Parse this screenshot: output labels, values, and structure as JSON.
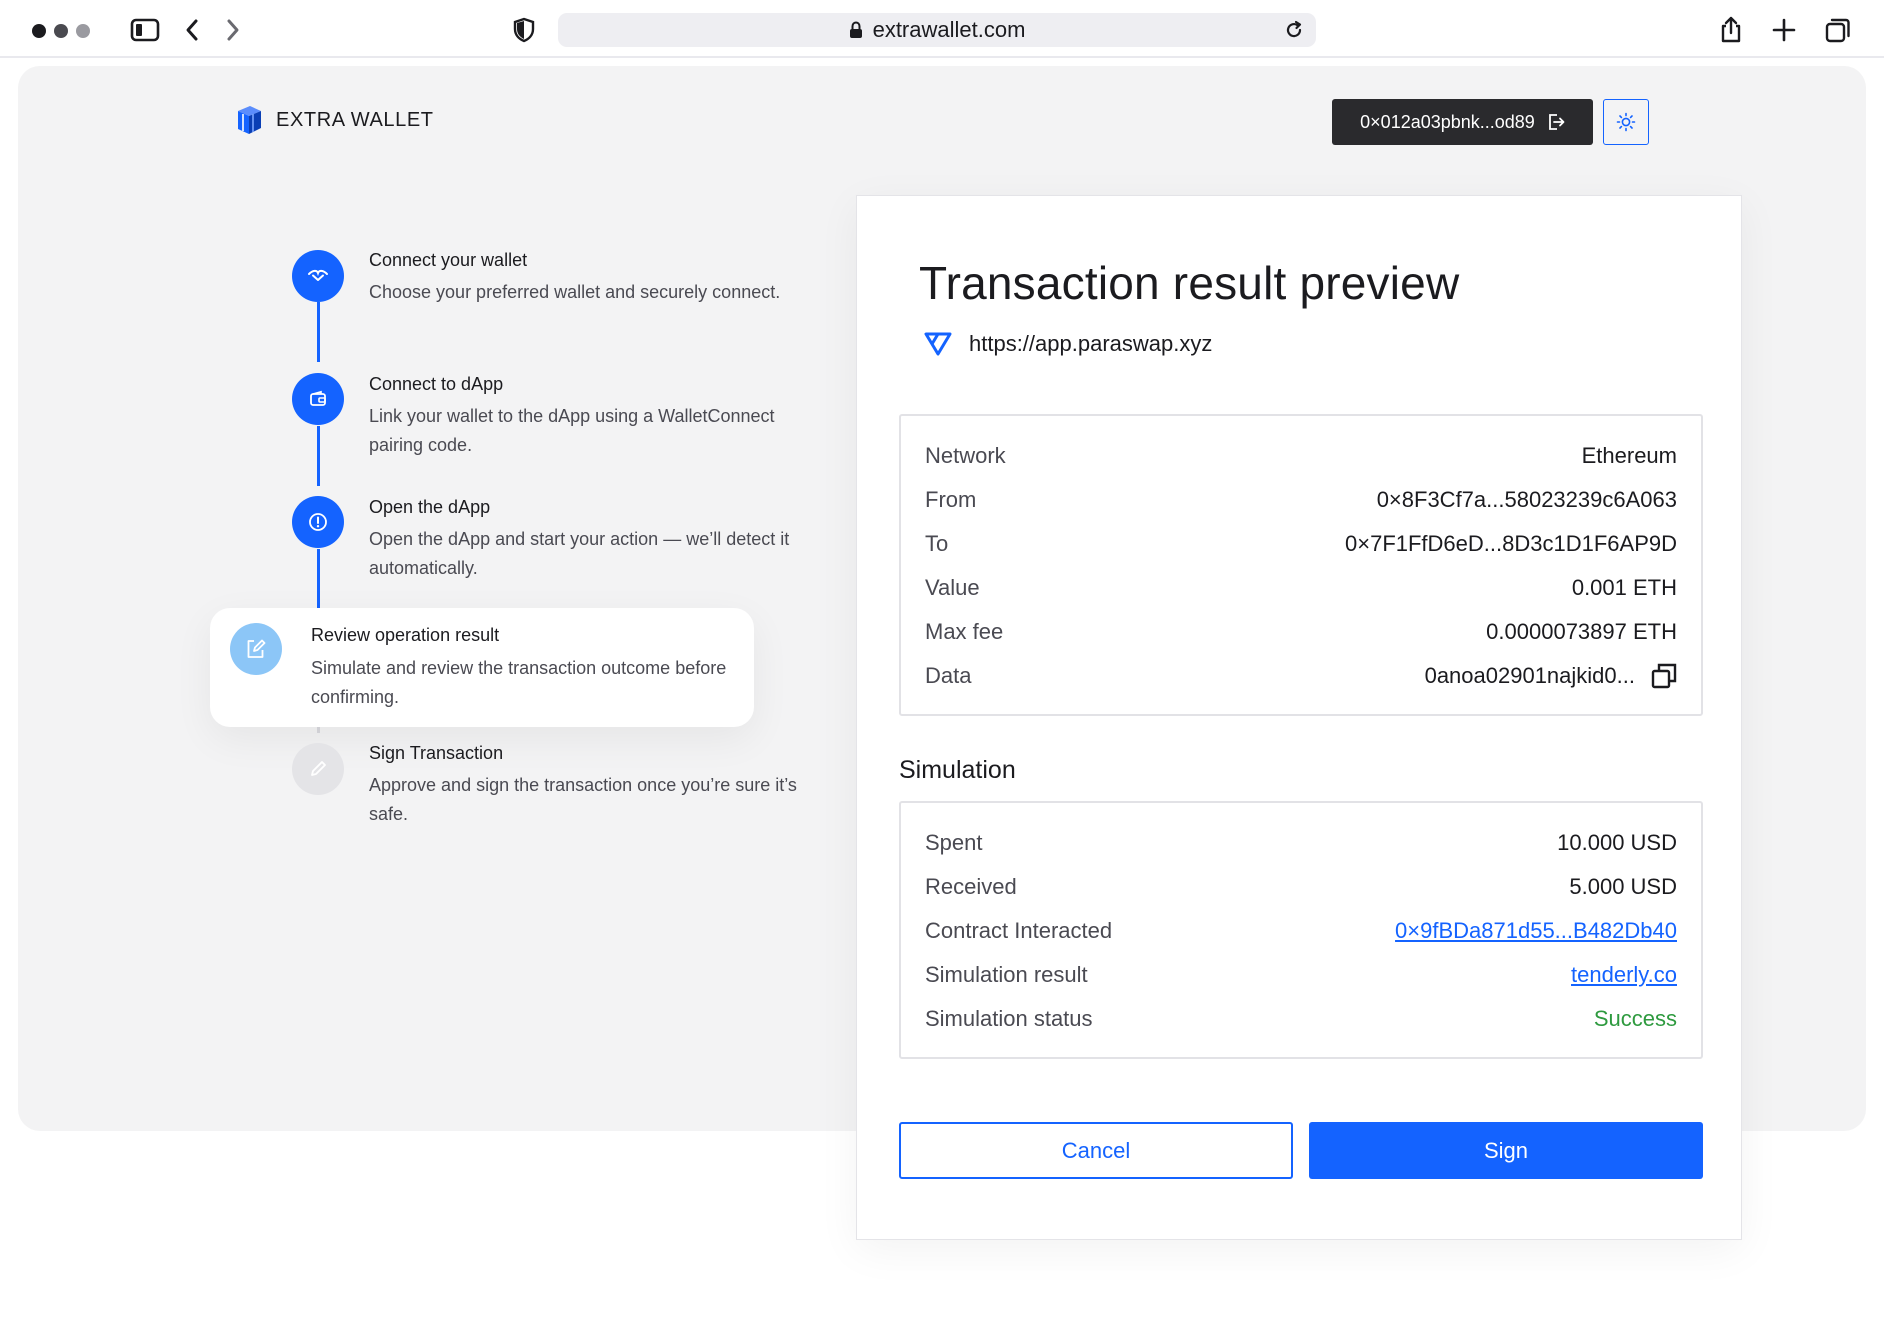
{
  "browser": {
    "url": "extrawallet.com"
  },
  "app": {
    "brand": "EXTRA WALLET",
    "address": "0×012a03pbnk...od89"
  },
  "steps": [
    {
      "title": "Connect your wallet",
      "desc": "Choose your preferred wallet and securely connect.",
      "icon": "wave-icon",
      "state": "done"
    },
    {
      "title": "Connect to dApp",
      "desc": "Link your wallet to the dApp using a WalletConnect pairing code.",
      "icon": "wallet-icon",
      "state": "done"
    },
    {
      "title": "Open the dApp",
      "desc": "Open the dApp and start your action — we’ll detect it automatically.",
      "icon": "info-icon",
      "state": "done"
    },
    {
      "title": "Review operation result",
      "desc": "Simulate and review the transaction outcome before confirming.",
      "icon": "edit-doc-icon",
      "state": "active"
    },
    {
      "title": "Sign Transaction",
      "desc": "Approve and sign the transaction once you’re sure it’s safe.",
      "icon": "pen-icon",
      "state": "pending"
    }
  ],
  "transaction": {
    "title": "Transaction result preview",
    "dapp_url": "https://app.paraswap.xyz",
    "details": [
      {
        "label": "Network",
        "value": "Ethereum"
      },
      {
        "label": "From",
        "value": "0×8F3Cf7a...58023239c6A063"
      },
      {
        "label": "To",
        "value": "0×7F1FfD6eD...8D3c1D1F6AP9D"
      },
      {
        "label": "Value",
        "value": "0.001 ETH"
      },
      {
        "label": "Max fee",
        "value": "0.0000073897 ETH"
      },
      {
        "label": "Data",
        "value": "0anoa02901najkid0..."
      }
    ],
    "simulation_title": "Simulation",
    "simulation": [
      {
        "label": "Spent",
        "value": "10.000 USD"
      },
      {
        "label": "Received",
        "value": "5.000 USD"
      },
      {
        "label": "Contract Interacted",
        "value": "0×9fBDa871d55...B482Db40"
      },
      {
        "label": "Simulation result",
        "value": "tenderly.co"
      },
      {
        "label": "Simulation status",
        "value": "Success"
      }
    ],
    "cancel_label": "Cancel",
    "sign_label": "Sign"
  },
  "colors": {
    "accent": "#1463ff",
    "success": "#2e9a3f",
    "page_bg": "#f3f3f4"
  }
}
